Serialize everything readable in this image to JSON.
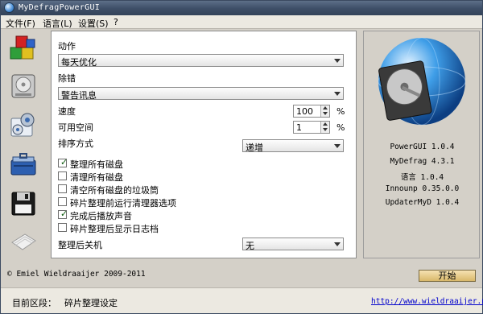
{
  "window": {
    "title": "MyDefragPowerGUI"
  },
  "menu": [
    {
      "label": "文件(F)"
    },
    {
      "label": "语言(L)"
    },
    {
      "label": "设置(S)"
    },
    {
      "label": "?"
    }
  ],
  "sidebar": {
    "icons": [
      "blocks-icon",
      "hard-disk-icon",
      "settings-gears-icon",
      "toolbox-icon",
      "floppy-disk-icon",
      "paper-icon"
    ]
  },
  "form": {
    "action_label": "动作",
    "action_value": "每天优化",
    "debug_label": "除错",
    "debug_value": "警告讯息",
    "speed_label": "速度",
    "speed_value": "100",
    "speed_unit": "%",
    "freespace_label": "可用空间",
    "freespace_value": "1",
    "freespace_unit": "%",
    "sort_label": "排序方式",
    "sort_value": "递增",
    "checkboxes": [
      {
        "label": "整理所有磁盘",
        "checked": true
      },
      {
        "label": "清理所有磁盘",
        "checked": false
      },
      {
        "label": "清空所有磁盘的垃圾筒",
        "checked": false
      },
      {
        "label": "碎片整理前运行清理器选项",
        "checked": false
      },
      {
        "label": "完成后播放声音",
        "checked": true
      },
      {
        "label": "碎片整理后显示日志档",
        "checked": false
      }
    ],
    "shutdown_label": "整理后关机",
    "shutdown_value": "无"
  },
  "versions": [
    "PowerGUI 1.0.4",
    "MyDefrag 4.3.1",
    "语言 1.0.4",
    "Innounp 0.35.0.0",
    "UpdaterMyD 1.0.4"
  ],
  "copyright": "© Emiel Wieldraaijer 2009-2011",
  "start_button": "开始",
  "status": {
    "label": "目前区段：",
    "value": "碎片整理设定",
    "link": "http://www.wieldraaijer.nl"
  },
  "checkmark": "✓"
}
